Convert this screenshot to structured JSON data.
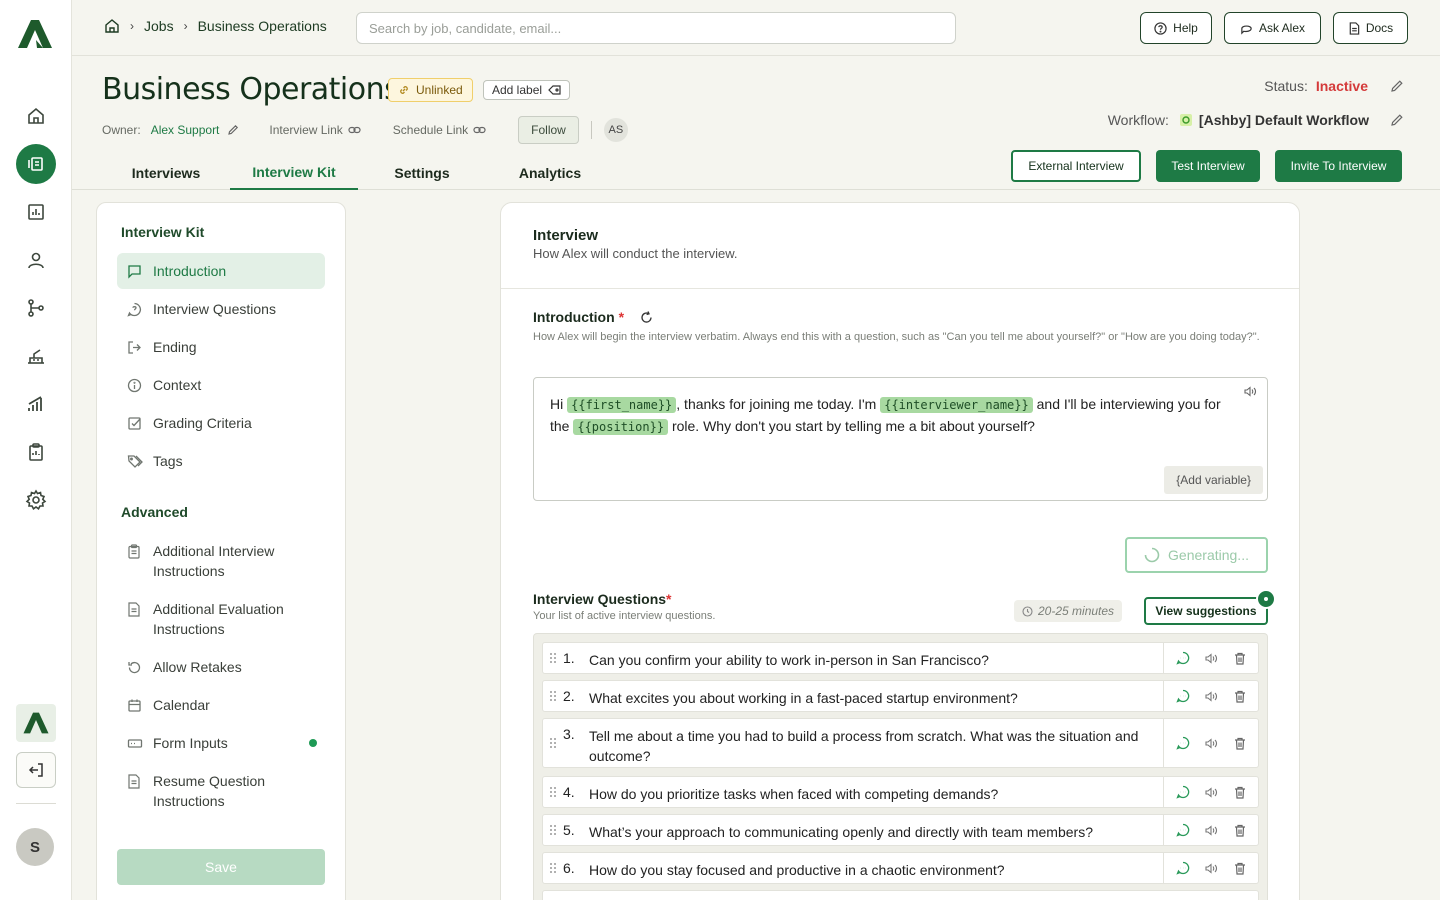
{
  "breadcrumb": {
    "jobs": "Jobs",
    "current": "Business Operations"
  },
  "search": {
    "placeholder": "Search by job, candidate, email..."
  },
  "topbar": {
    "help": "Help",
    "ask": "Ask Alex",
    "docs": "Docs"
  },
  "job": {
    "title": "Business Operations",
    "link_status": "Unlinked",
    "add_label": "Add label",
    "owner_label": "Owner:",
    "owner_name": "Alex Support",
    "interview_link": "Interview Link",
    "schedule_link": "Schedule Link",
    "follow": "Follow",
    "avatar_initials": "AS",
    "status_label": "Status:",
    "status_value": "Inactive",
    "workflow_label": "Workflow:",
    "workflow_name": "[Ashby] Default Workflow"
  },
  "tabs": [
    "Interviews",
    "Interview Kit",
    "Settings",
    "Analytics"
  ],
  "header_buttons": {
    "external": "External Interview",
    "test": "Test Interview",
    "invite": "Invite To Interview"
  },
  "sidebar": {
    "heading": "Interview Kit",
    "items": [
      "Introduction",
      "Interview Questions",
      "Ending",
      "Context",
      "Grading Criteria",
      "Tags"
    ],
    "advanced_heading": "Advanced",
    "advanced_items": [
      "Additional Interview Instructions",
      "Additional Evaluation Instructions",
      "Allow Retakes",
      "Calendar",
      "Form Inputs",
      "Resume Question Instructions"
    ],
    "save": "Save"
  },
  "user": {
    "initial": "S"
  },
  "interview": {
    "title": "Interview",
    "subtitle": "How Alex will conduct the interview.",
    "intro_label": "Introduction",
    "required_mark": "*",
    "intro_help": "How Alex will begin the interview verbatim. Always end this with a question, such as \"Can you tell me about yourself?\" or \"How are you doing today?\".",
    "intro_parts": {
      "p1": "Hi ",
      "v1": "{{first_name}}",
      "p2": ", thanks for joining me today. I'm ",
      "v2": "{{interviewer_name}}",
      "p3": " and I'll be interviewing you for the ",
      "v3": "{{position}}",
      "p4": " role. Why don't you start by telling me a bit about yourself?"
    },
    "add_variable": "{Add variable}",
    "generating": "Generating...",
    "questions_label": "Interview Questions",
    "questions_sub": "Your list of active interview questions.",
    "duration": "20-25 minutes",
    "view_suggestions": "View suggestions"
  },
  "questions": [
    {
      "num": "1.",
      "text": "Can you confirm your ability to work in-person in San Francisco?"
    },
    {
      "num": "2.",
      "text": "What excites you about working in a fast-paced startup environment?"
    },
    {
      "num": "3.",
      "text": "Tell me about a time you had to build a process from scratch. What was the situation and outcome?"
    },
    {
      "num": "4.",
      "text": "How do you prioritize tasks when faced with competing demands?"
    },
    {
      "num": "5.",
      "text": "What’s your approach to communicating openly and directly with team members?"
    },
    {
      "num": "6.",
      "text": "How do you stay focused and productive in a chaotic environment?"
    }
  ],
  "colors": {
    "brand": "#1e7a45",
    "inactive": "#d43a3a",
    "variable_bg": "#a8d9a1"
  }
}
